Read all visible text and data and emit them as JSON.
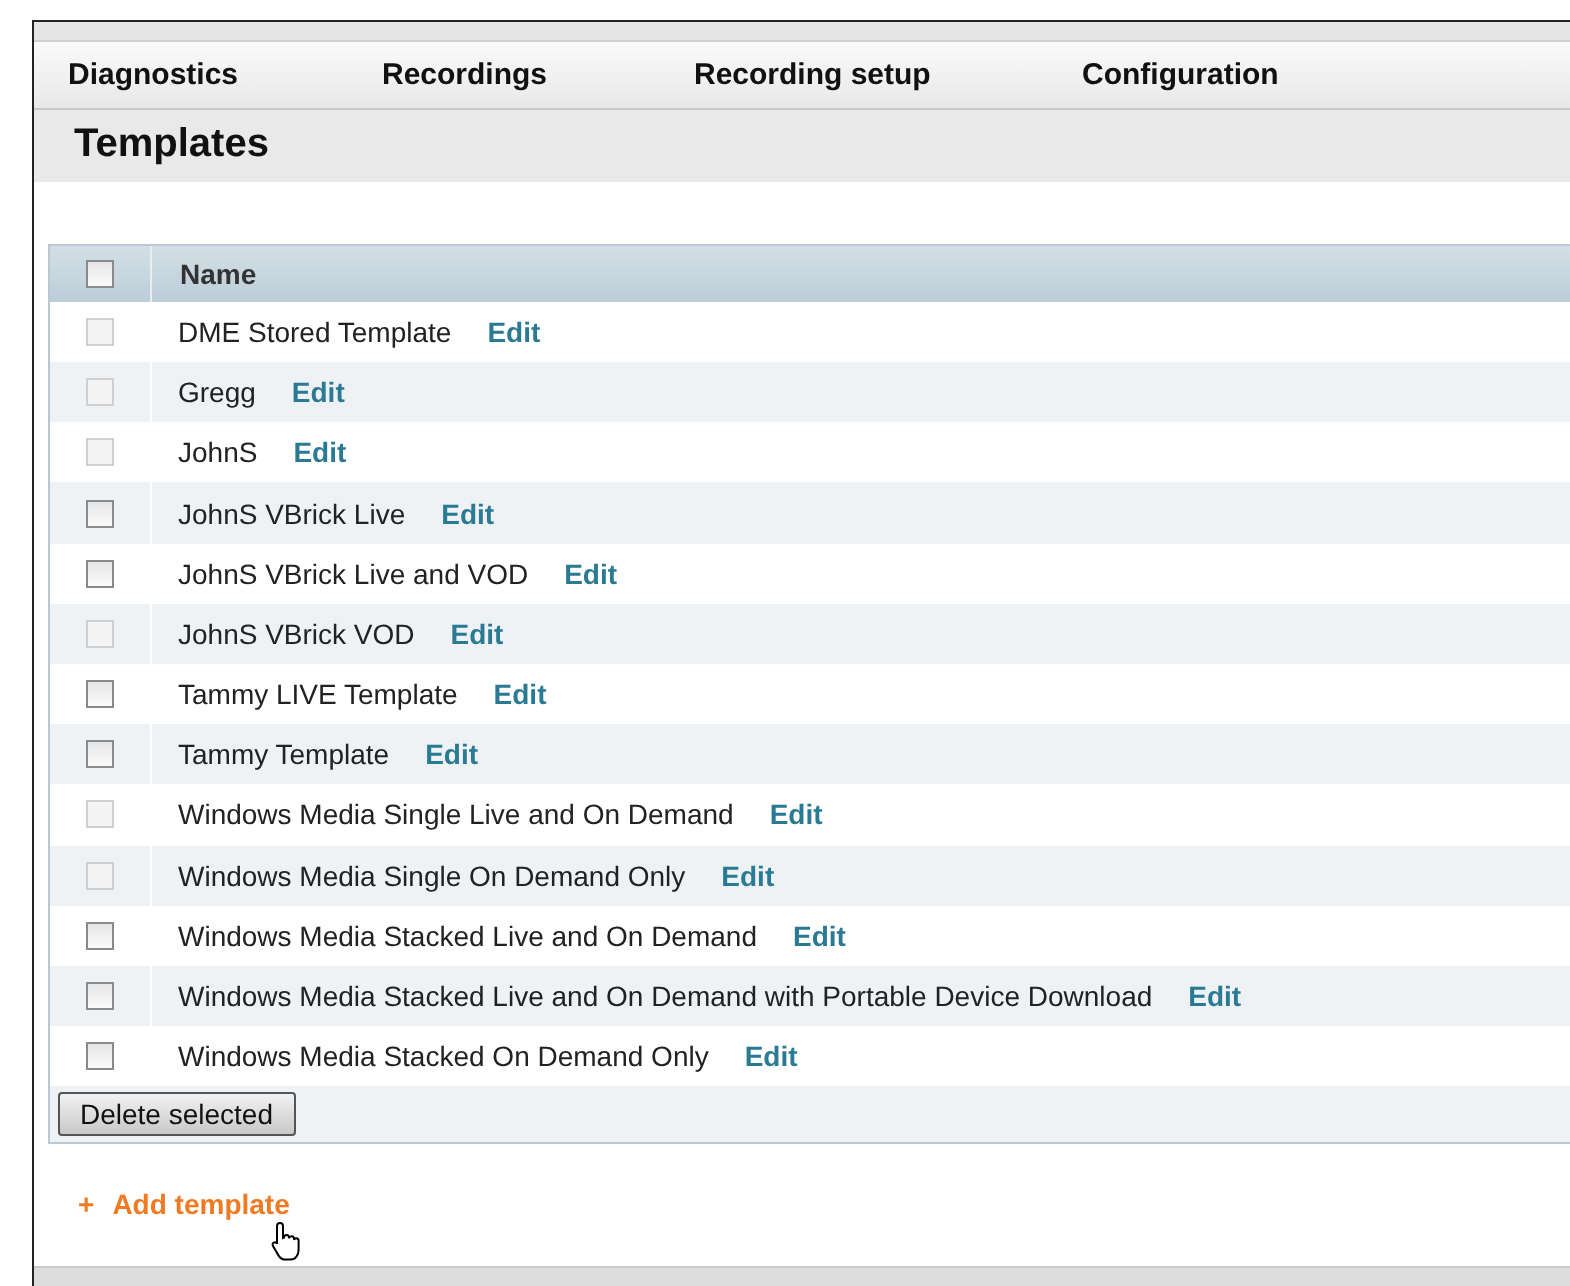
{
  "nav": [
    {
      "label": "Diagnostics"
    },
    {
      "label": "Recordings"
    },
    {
      "label": "Recording setup"
    },
    {
      "label": "Configuration"
    }
  ],
  "page_title": "Templates",
  "table": {
    "select_all_checked": false,
    "column": "Name",
    "rows": [
      {
        "name": "DME Stored Template",
        "action": "Edit",
        "disabled": true,
        "checked": false
      },
      {
        "name": "Gregg",
        "action": "Edit",
        "disabled": true,
        "checked": false
      },
      {
        "name": "JohnS",
        "action": "Edit",
        "disabled": true,
        "checked": false
      },
      {
        "name": "JohnS VBrick Live",
        "action": "Edit",
        "disabled": false,
        "checked": false
      },
      {
        "name": "JohnS VBrick Live and VOD",
        "action": "Edit",
        "disabled": false,
        "checked": false
      },
      {
        "name": "JohnS VBrick VOD",
        "action": "Edit",
        "disabled": true,
        "checked": false
      },
      {
        "name": "Tammy LIVE Template",
        "action": "Edit",
        "disabled": false,
        "checked": false
      },
      {
        "name": "Tammy Template",
        "action": "Edit",
        "disabled": false,
        "checked": false
      },
      {
        "name": "Windows Media Single Live and On Demand",
        "action": "Edit",
        "disabled": true,
        "checked": false
      },
      {
        "name": "Windows Media Single On Demand Only",
        "action": "Edit",
        "disabled": true,
        "checked": false
      },
      {
        "name": "Windows Media Stacked Live and On Demand",
        "action": "Edit",
        "disabled": false,
        "checked": false
      },
      {
        "name": "Windows Media Stacked Live and On Demand with Portable Device Download",
        "action": "Edit",
        "disabled": false,
        "checked": false
      },
      {
        "name": "Windows Media Stacked On Demand Only",
        "action": "Edit",
        "disabled": false,
        "checked": false
      }
    ],
    "delete_button": "Delete selected"
  },
  "add_link": {
    "icon": "+",
    "label": "Add template"
  }
}
